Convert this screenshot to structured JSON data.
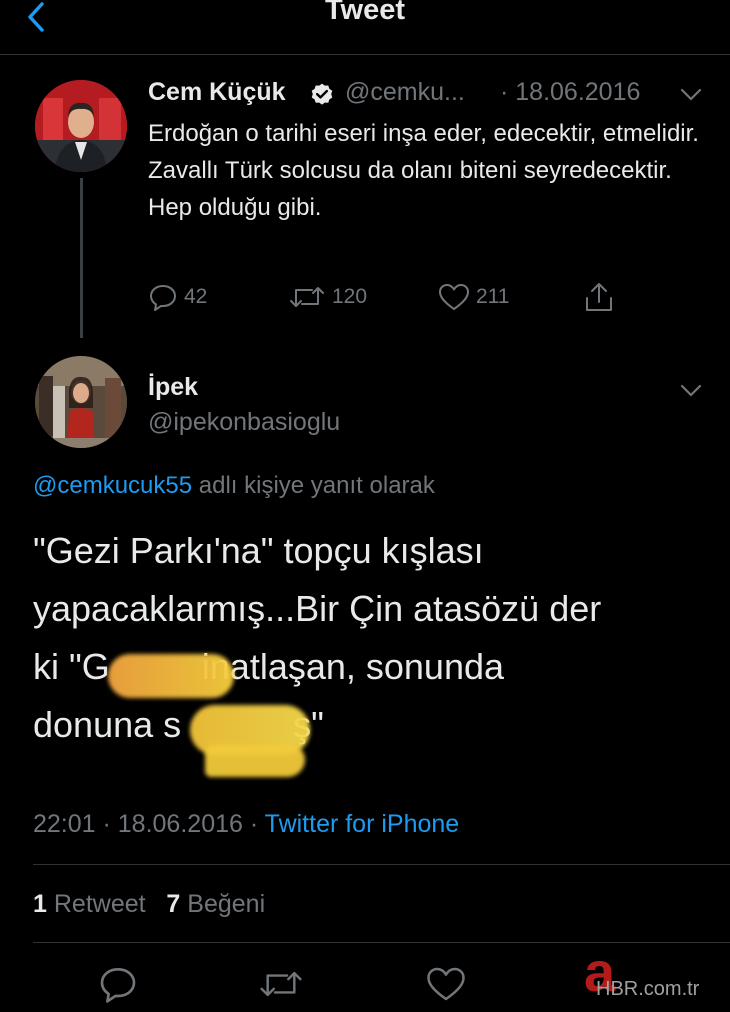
{
  "header": {
    "title": "Tweet"
  },
  "tweet1": {
    "name": "Cem Küçük",
    "handle": "@cemku...",
    "date": "· 18.06.2016",
    "text": "Erdoğan o tarihi eseri inşa eder, edecektir, etmelidir. Zavallı Türk solcusu da olanı biteni seyredecektir. Hep olduğu gibi.",
    "replies": "42",
    "retweets": "120",
    "likes": "211"
  },
  "tweet2": {
    "name": "İpek",
    "handle": "@ipekonbasioglu",
    "reply_mention": "@cemkucuk55",
    "reply_suffix": "adlı kişiye yanıt olarak",
    "line1": "\"Gezi Parkı'na\" topçu kışlası",
    "line2": "yapacaklarmış...Bir Çin atasözü der",
    "line3_start": "ki \"G",
    "line3_end": "inatlaşan, sonunda",
    "line4_start": "donuna s",
    "line4_end": "ş\"",
    "time": "22:01 · 18.06.2016 ·",
    "source": "Twitter for iPhone",
    "retweet_count": "1",
    "retweet_label": "Retweet",
    "like_count": "7",
    "like_label": "Beğeni"
  },
  "watermark": {
    "logo_letter": "a",
    "text": "HBR.com.tr"
  },
  "colors": {
    "accent": "#1d9bf0",
    "muted": "#71767b",
    "background": "#000000"
  },
  "icons": [
    "back-chevron-icon",
    "verified-badge-icon",
    "chevron-down-icon",
    "reply-icon",
    "retweet-icon",
    "like-icon",
    "share-icon"
  ]
}
